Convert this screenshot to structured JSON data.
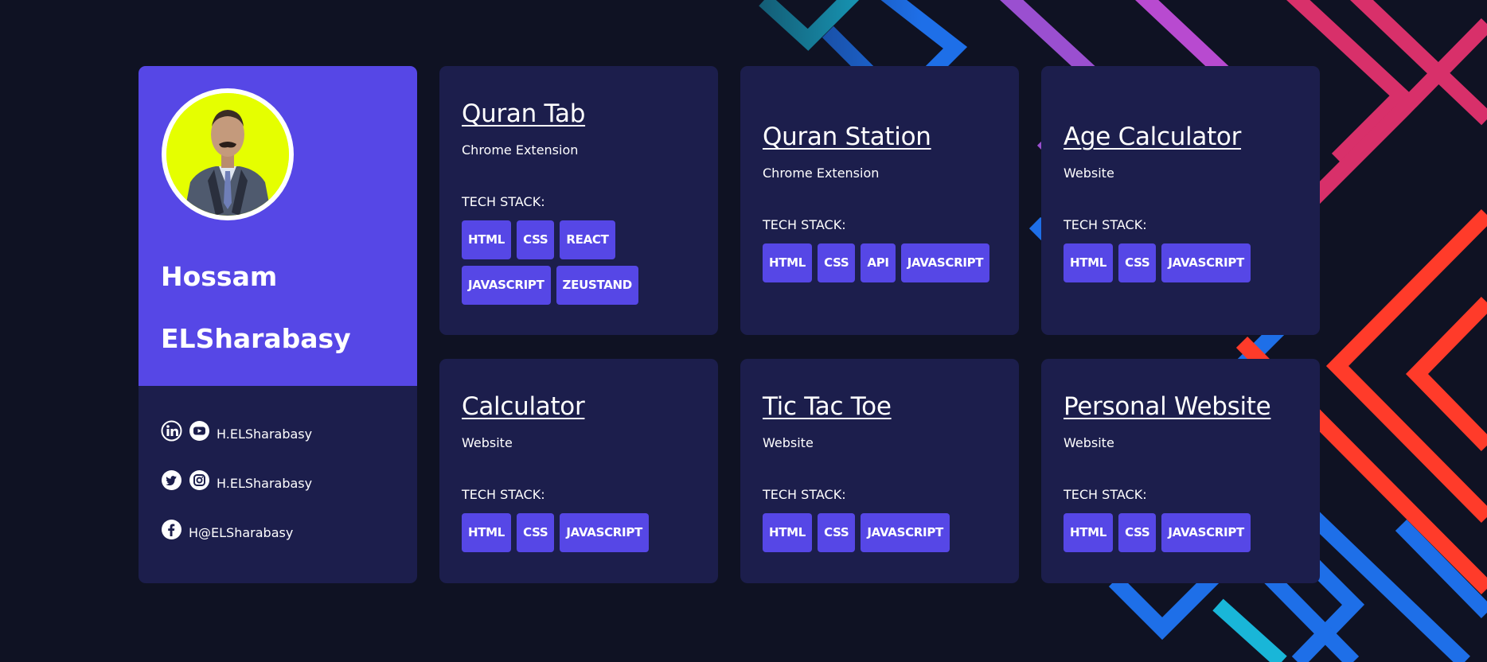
{
  "colors": {
    "background": "#0f1223",
    "card": "#1c1e4c",
    "accent": "#5647e6",
    "avatar_bg": "#e5ff00",
    "text": "#ffffff"
  },
  "profile": {
    "first_name": "Hossam",
    "last_name": "ELSharabasy",
    "socials": [
      {
        "icons": [
          "linkedin-icon",
          "youtube-icon"
        ],
        "handle": "H.ELSharabasy"
      },
      {
        "icons": [
          "twitter-icon",
          "instagram-icon"
        ],
        "handle": "H.ELSharabasy"
      },
      {
        "icons": [
          "facebook-icon"
        ],
        "handle": "H@ELSharabasy"
      }
    ]
  },
  "tech_stack_label": "TECH STACK:",
  "projects": [
    {
      "title": "Quran Tab",
      "type": "Chrome Extension",
      "tags": [
        "HTML",
        "CSS",
        "REACT",
        "JAVASCRIPT",
        "ZEUSTAND"
      ]
    },
    {
      "title": "Quran Station",
      "type": "Chrome Extension",
      "tags": [
        "HTML",
        "CSS",
        "API",
        "JAVASCRIPT"
      ]
    },
    {
      "title": "Age Calculator",
      "type": "Website",
      "tags": [
        "HTML",
        "CSS",
        "JAVASCRIPT"
      ]
    },
    {
      "title": "Calculator",
      "type": "Website",
      "tags": [
        "HTML",
        "CSS",
        "JAVASCRIPT"
      ]
    },
    {
      "title": "Tic Tac Toe",
      "type": "Website",
      "tags": [
        "HTML",
        "CSS",
        "JAVASCRIPT"
      ]
    },
    {
      "title": "Personal Website",
      "type": "Website",
      "tags": [
        "HTML",
        "CSS",
        "JAVASCRIPT"
      ]
    }
  ]
}
